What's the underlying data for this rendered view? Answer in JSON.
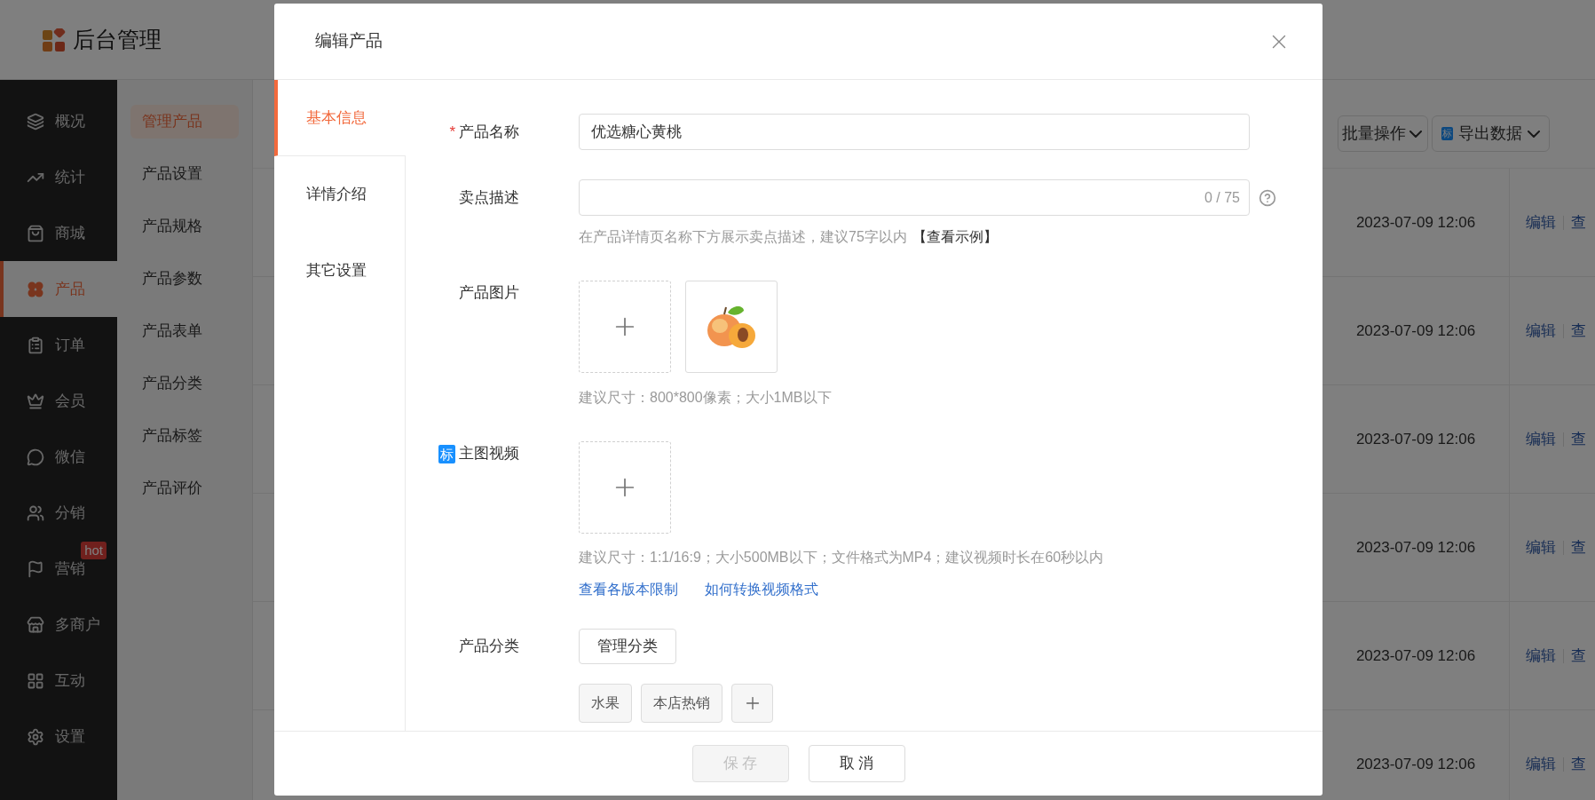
{
  "header": {
    "title": "后台管理"
  },
  "sidebar": {
    "items": [
      {
        "label": "概况",
        "selected": false
      },
      {
        "label": "统计",
        "selected": false
      },
      {
        "label": "商城",
        "selected": false
      },
      {
        "label": "产品",
        "selected": true
      },
      {
        "label": "订单",
        "selected": false
      },
      {
        "label": "会员",
        "selected": false
      },
      {
        "label": "微信",
        "selected": false
      },
      {
        "label": "分销",
        "selected": false
      },
      {
        "label": "营销",
        "selected": false,
        "badge": "hot"
      },
      {
        "label": "多商户",
        "selected": false
      },
      {
        "label": "互动",
        "selected": false
      },
      {
        "label": "设置",
        "selected": false
      }
    ]
  },
  "submenu": {
    "items": [
      {
        "label": "管理产品",
        "selected": true
      },
      {
        "label": "产品设置",
        "selected": false
      },
      {
        "label": "产品规格",
        "selected": false
      },
      {
        "label": "产品参数",
        "selected": false
      },
      {
        "label": "产品表单",
        "selected": false
      },
      {
        "label": "产品分类",
        "selected": false
      },
      {
        "label": "产品标签",
        "selected": false
      },
      {
        "label": "产品评价",
        "selected": false
      }
    ]
  },
  "toolbar": {
    "buttons": [
      {
        "label": "批量操作"
      },
      {
        "label": "导出数据",
        "badge": "标"
      }
    ]
  },
  "table": {
    "rows": [
      {
        "time": "2023-07-09 12:06",
        "actions": [
          "编辑",
          "查"
        ]
      },
      {
        "time": "2023-07-09 12:06",
        "actions": [
          "编辑",
          "查"
        ]
      },
      {
        "time": "2023-07-09 12:06",
        "actions": [
          "编辑",
          "查"
        ]
      },
      {
        "time": "2023-07-09 12:06",
        "actions": [
          "编辑",
          "查"
        ]
      },
      {
        "time": "2023-07-09 12:06",
        "actions": [
          "编辑",
          "查"
        ]
      },
      {
        "time": "2023-07-09 12:06",
        "actions": [
          "编辑",
          "查"
        ]
      }
    ]
  },
  "modal": {
    "title": "编辑产品",
    "tabs": [
      {
        "label": "基本信息",
        "selected": true
      },
      {
        "label": "详情介绍",
        "selected": false
      },
      {
        "label": "其它设置",
        "selected": false
      }
    ],
    "form": [
      {
        "kind": "text",
        "label": "产品名称",
        "required_mark": "*",
        "value": "优选糖心黄桃"
      },
      {
        "kind": "counted",
        "label": "卖点描述",
        "counter": "0 / 75",
        "hint": "在产品详情页名称下方展示卖点描述，建议75字以内",
        "hint_link": "【查看示例】"
      },
      {
        "kind": "images",
        "label": "产品图片",
        "hint": "建议尺寸：800*800像素；大小1MB以下"
      },
      {
        "kind": "video",
        "label": "主图视频",
        "badge": "标",
        "hint": "建议尺寸：1:1/16:9；大小500MB以下；文件格式为MP4；建议视频时长在60秒以内",
        "links": [
          "查看各版本限制",
          "如何转换视频格式"
        ]
      },
      {
        "kind": "category",
        "label": "产品分类",
        "button": "管理分类",
        "tags": [
          "水果",
          "本店热销"
        ]
      }
    ],
    "footer": [
      {
        "label": "保 存",
        "disabled": true
      },
      {
        "label": "取 消",
        "disabled": false
      }
    ]
  }
}
